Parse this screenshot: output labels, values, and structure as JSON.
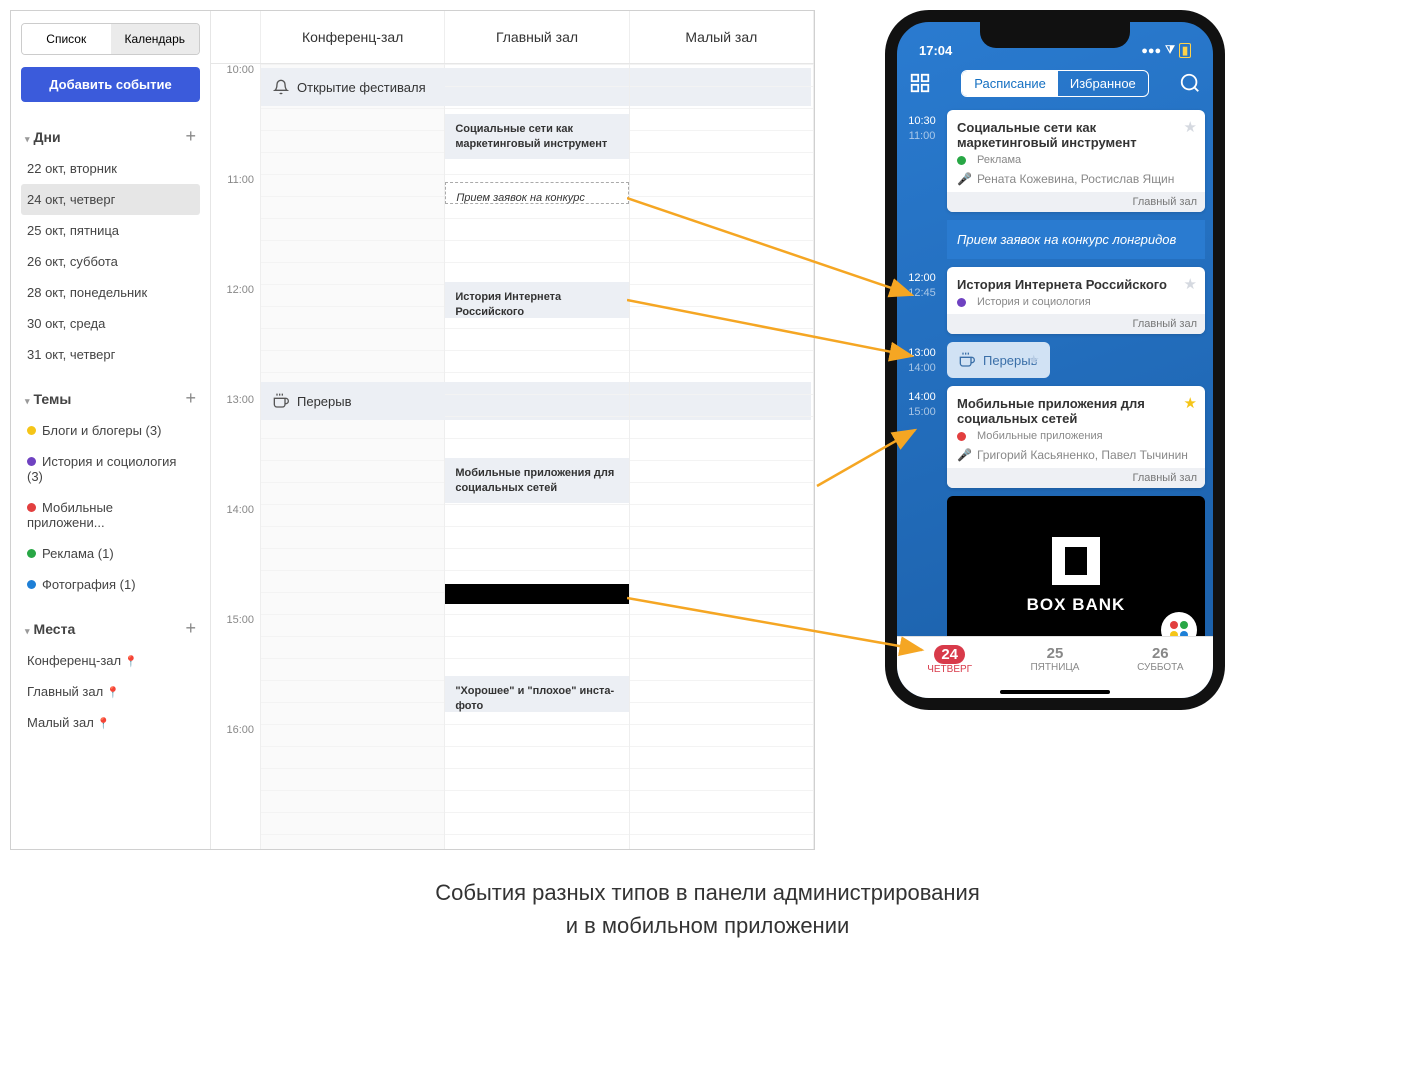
{
  "sidebar": {
    "toggle": {
      "list": "Список",
      "calendar": "Календарь"
    },
    "add_event": "Добавить событие",
    "sections": {
      "days": {
        "title": "Дни",
        "items": [
          "22 окт, вторник",
          "24 окт, четверг",
          "25 окт, пятница",
          "26 окт, суббота",
          "28 окт, понедельник",
          "30 окт, среда",
          "31 окт, четверг"
        ]
      },
      "themes": {
        "title": "Темы",
        "items": [
          {
            "color": "#f5c518",
            "label": "Блоги и блогеры (3)"
          },
          {
            "color": "#6f42c1",
            "label": "История и социология (3)"
          },
          {
            "color": "#e23f3f",
            "label": "Мобильные приложени..."
          },
          {
            "color": "#28a745",
            "label": "Реклама (1)"
          },
          {
            "color": "#1e7fd6",
            "label": "Фотография (1)"
          }
        ]
      },
      "places": {
        "title": "Места",
        "items": [
          "Конференц-зал",
          "Главный зал",
          "Малый зал"
        ]
      }
    }
  },
  "calendar": {
    "rooms": [
      "Конференц-зал",
      "Главный зал",
      "Малый зал"
    ],
    "hours": [
      "10:00",
      "11:00",
      "12:00",
      "13:00",
      "14:00",
      "15:00",
      "16:00"
    ],
    "events": {
      "opening": "Открытие фестиваля",
      "social": "Социальные сети как маркетинговый инструмент",
      "applications": "Прием заявок на конкурс",
      "history": "История Интернета Российского",
      "break": "Перерыв",
      "mobile": "Мобильные приложения для социальных сетей",
      "insta": "\"Хорошее\" и \"плохое\" инста-фото"
    }
  },
  "phone": {
    "time": "17:04",
    "tabs": {
      "schedule": "Расписание",
      "favorites": "Избранное"
    },
    "items": {
      "social": {
        "t1": "10:30",
        "t2": "11:00",
        "title": "Социальные сети как маркетинговый инструмент",
        "cat": "Реклама",
        "cat_color": "#28a745",
        "speakers": "Рената Кожевина, Ростислав Ящин",
        "room": "Главный зал"
      },
      "banner": "Прием заявок на конкурс лонгридов",
      "history": {
        "t1": "12:00",
        "t2": "12:45",
        "title": "История Интернета Российского",
        "cat": "История и социология",
        "cat_color": "#6f42c1",
        "room": "Главный зал"
      },
      "break": {
        "t1": "13:00",
        "t2": "14:00",
        "title": "Перерыв"
      },
      "mobile": {
        "t1": "14:00",
        "t2": "15:00",
        "title": "Мобильные приложения для социальных сетей",
        "cat": "Мобильные приложения",
        "cat_color": "#e23f3f",
        "speakers": "Григорий Касьяненко, Павел Тычинин",
        "room": "Главный зал"
      },
      "ad_brand": "BOX BANK"
    },
    "bottom": [
      {
        "num": "24",
        "label": "ЧЕТВЕРГ"
      },
      {
        "num": "25",
        "label": "ПЯТНИЦА"
      },
      {
        "num": "26",
        "label": "СУББОТА"
      }
    ]
  },
  "caption": {
    "l1": "События разных типов в панели администрирования",
    "l2": "и в мобильном приложении"
  }
}
